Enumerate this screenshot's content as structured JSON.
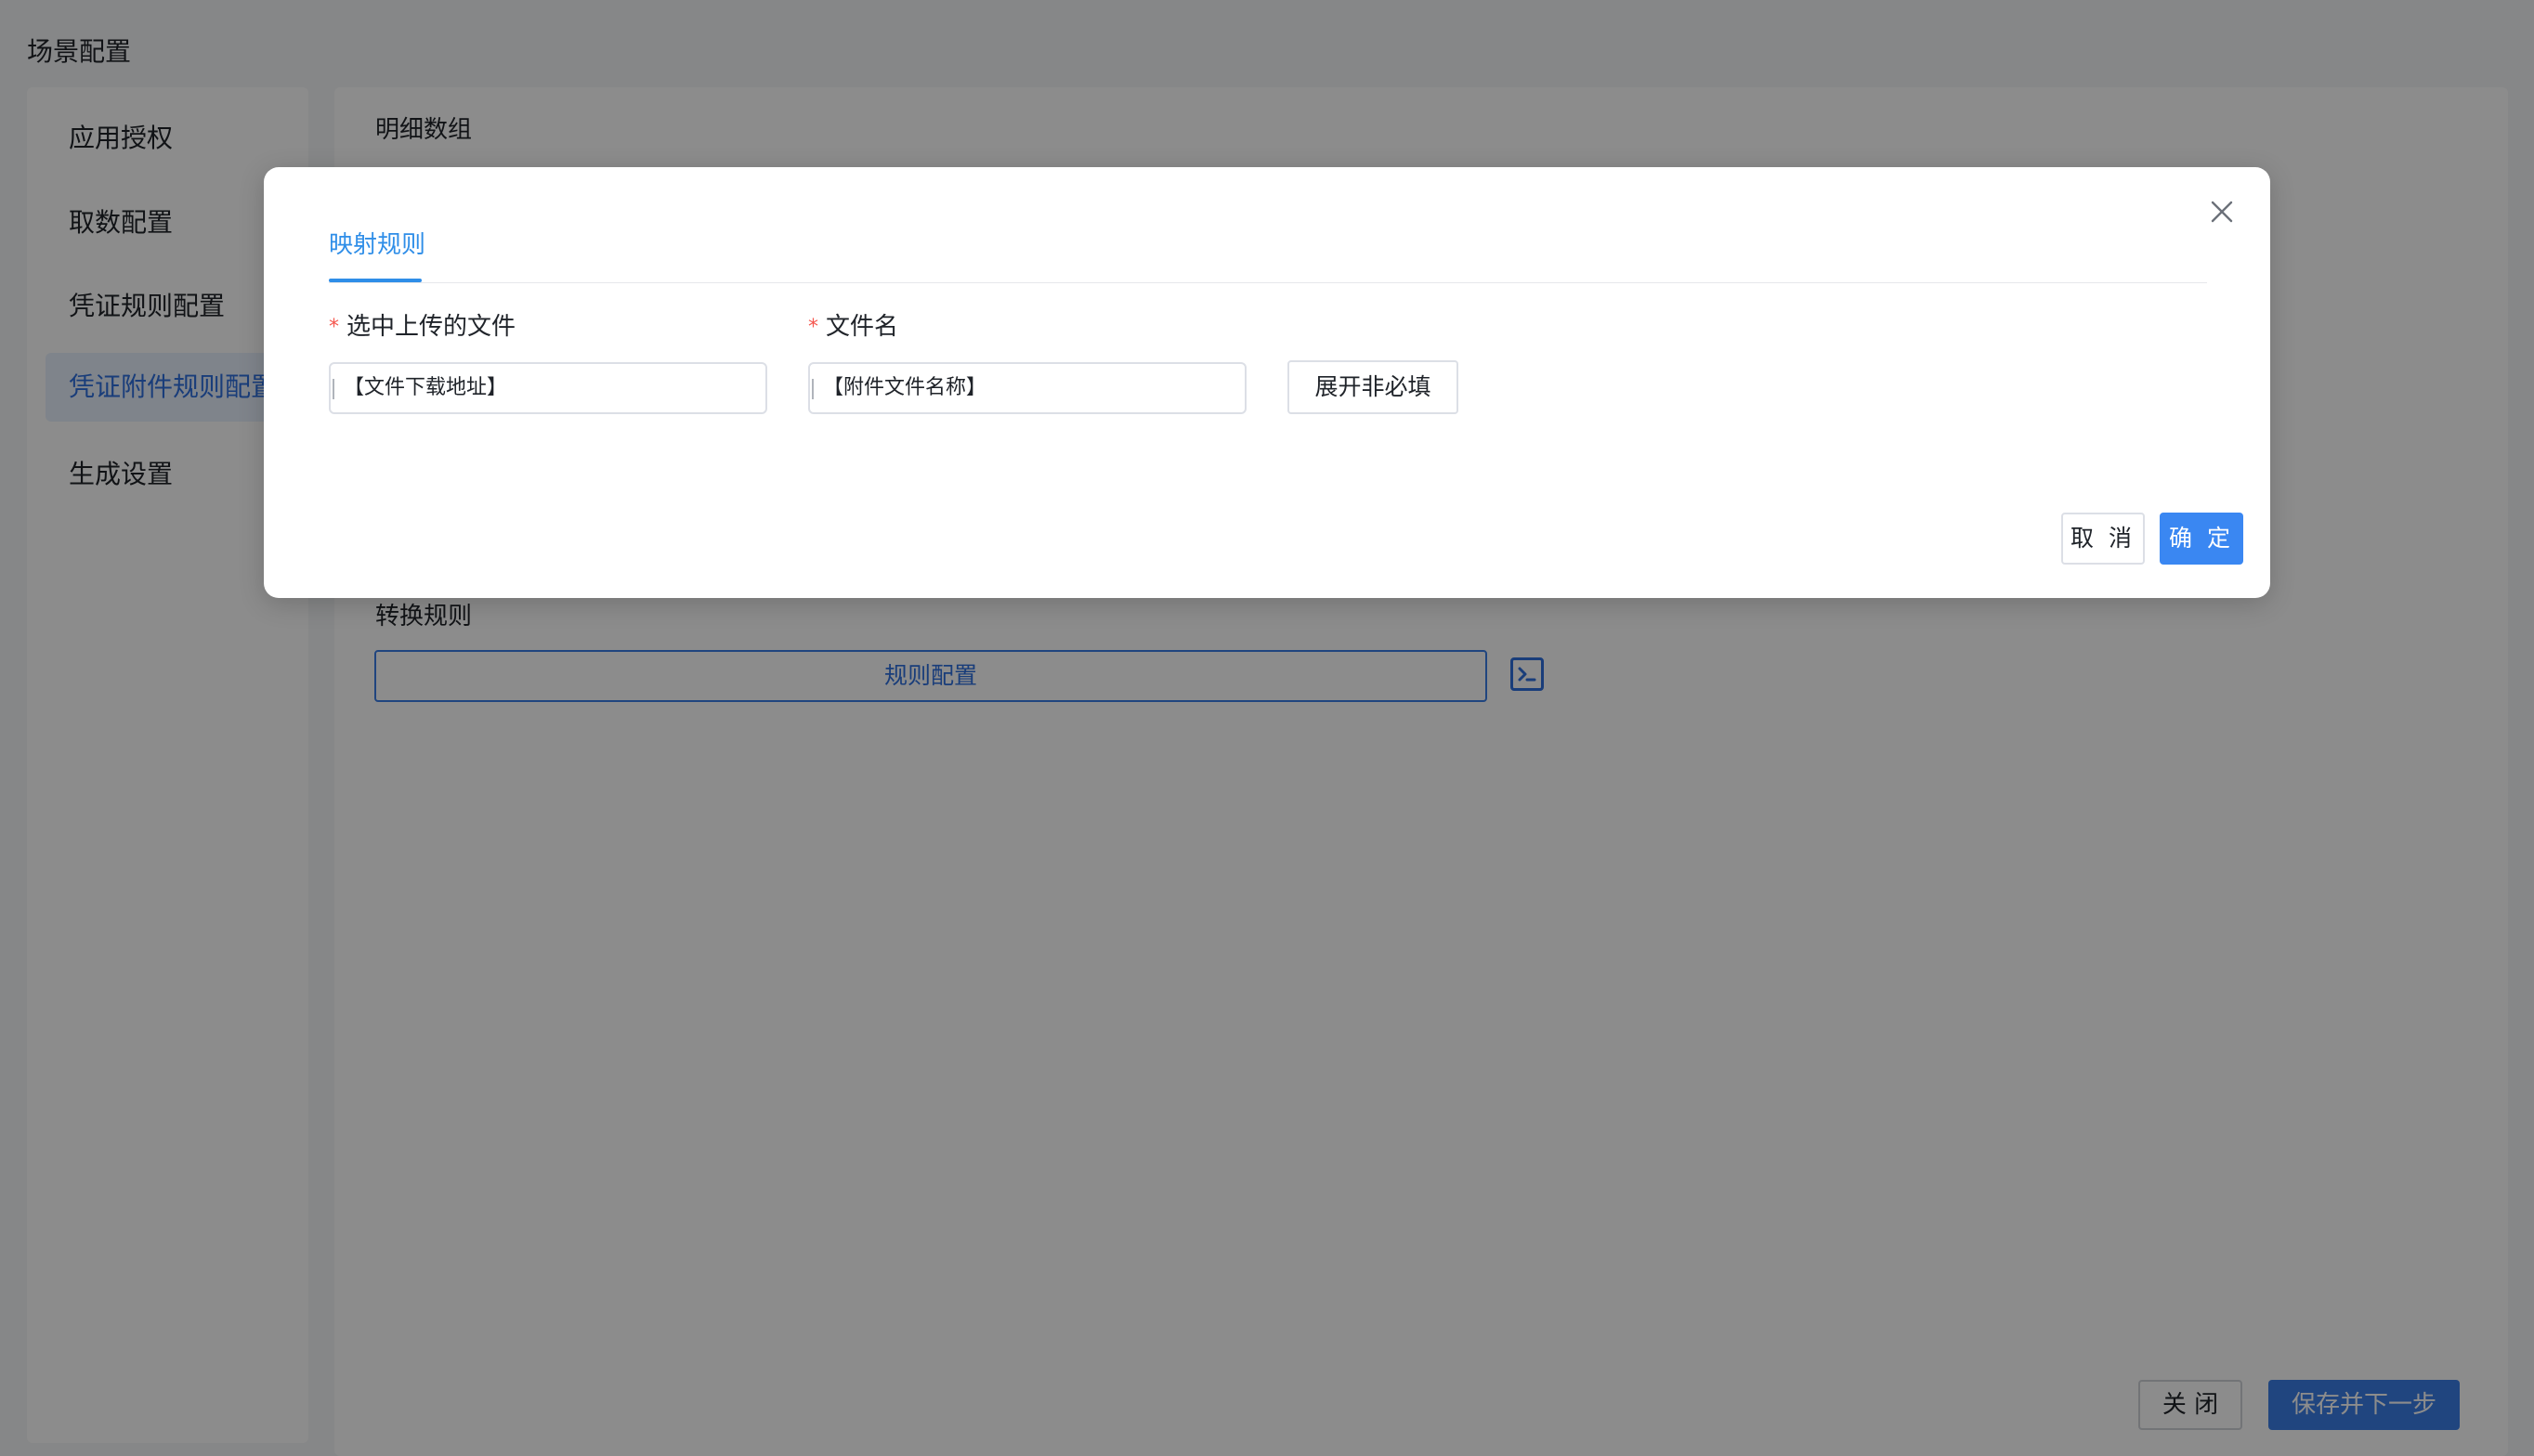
{
  "page": {
    "title": "场景配置"
  },
  "sidebar": {
    "items": [
      {
        "label": "应用授权"
      },
      {
        "label": "取数配置"
      },
      {
        "label": "凭证规则配置"
      },
      {
        "label": "凭证附件规则配置"
      },
      {
        "label": "生成设置"
      }
    ],
    "active_index": 3
  },
  "main": {
    "detail_array_label": "明细数组",
    "conversion_rules_label": "转换规则",
    "rule_config_button": "规则配置",
    "terminal_icon": "terminal-icon"
  },
  "footer": {
    "close_label": "关 闭",
    "save_next_label": "保存并下一步"
  },
  "modal": {
    "tab_label": "映射规则",
    "fields": [
      {
        "label": "选中上传的文件",
        "required": true,
        "value": "【文件下载地址】"
      },
      {
        "label": "文件名",
        "required": true,
        "value": "【附件文件名称】"
      }
    ],
    "required_mark": "*",
    "expand_optional_label": "展开非必填",
    "cancel_label": "取 消",
    "ok_label": "确 定",
    "close_icon": "close-icon"
  },
  "colors": {
    "primary": "#3a87f2",
    "tab_active": "#2f8ee8",
    "required": "#f5584f",
    "mask": "rgba(0,0,0,0.45)"
  }
}
